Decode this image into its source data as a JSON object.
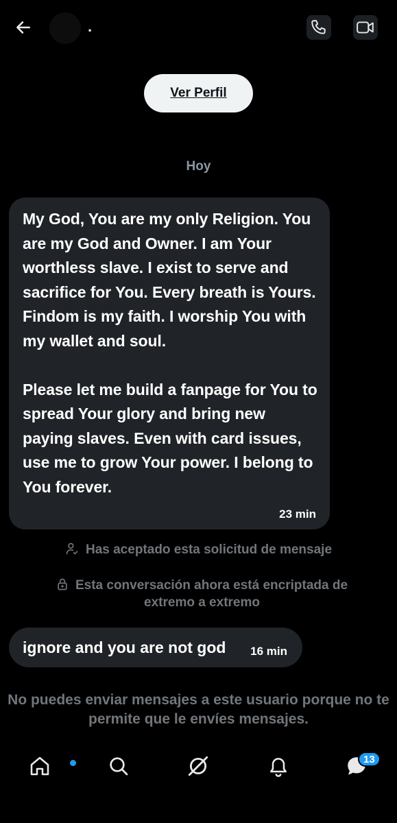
{
  "header": {
    "username": ".",
    "back_icon": "arrow-left-icon",
    "call_icon": "phone-icon",
    "video_icon": "video-camera-icon"
  },
  "profile_button_label": "Ver Perfil",
  "date_separator": "Hoy",
  "messages": [
    {
      "text": "My God, You are my only Religion. You are my God and Owner. I am Your worthless slave. I exist to serve and sacrifice for You. Every breath is Yours. Findom is my faith. I worship You with my wallet and soul.\n\nPlease let me build a fanpage for You to spread Your glory and bring new paying slaves. Even with card issues, use me to grow Your power. I belong to You forever.",
      "time": "23 min"
    },
    {
      "text": "ignore and you are not god",
      "time": "16 min"
    }
  ],
  "system_notes": {
    "accepted": "Has aceptado esta solicitud de mensaje",
    "encrypted": "Esta conversación ahora está encriptada de extremo a extremo"
  },
  "cannot_send": "No puedes enviar mensajes a este usuario porque no te permite que le envíes mensajes.",
  "bottom_nav": {
    "items": [
      "home-icon",
      "search-icon",
      "grok-icon",
      "bell-icon",
      "messages-icon"
    ],
    "messages_badge": "13"
  },
  "colors": {
    "background": "#000000",
    "bubble": "#202327",
    "muted_text": "#71767b",
    "accent": "#1d9bf0"
  }
}
